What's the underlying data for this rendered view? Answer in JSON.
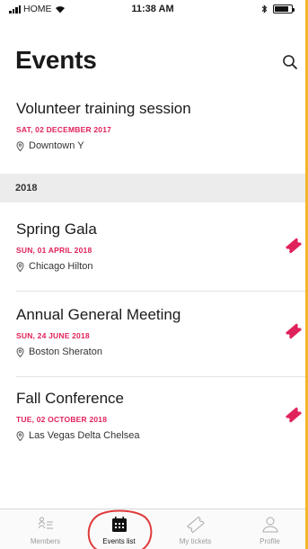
{
  "status_bar": {
    "carrier": "HOME",
    "time": "11:38 AM",
    "battery_level": 0.85
  },
  "header": {
    "title": "Events",
    "search_icon": "search-icon"
  },
  "events_top": [
    {
      "title": "Volunteer training session",
      "date": "SAT, 02 DECEMBER 2017",
      "location": "Downtown Y"
    }
  ],
  "section": {
    "label": "2018"
  },
  "events_2018": [
    {
      "title": "Spring Gala",
      "date": "SUN, 01 APRIL 2018",
      "location": "Chicago Hilton",
      "ticket_icon": "ticket-icon"
    },
    {
      "title": "Annual General Meeting",
      "date": "SUN, 24 JUNE 2018",
      "location": "Boston Sheraton",
      "ticket_icon": "ticket-icon"
    },
    {
      "title": "Fall Conference",
      "date": "TUE, 02 OCTOBER 2018",
      "location": "Las Vegas Delta Chelsea",
      "ticket_icon": "ticket-icon"
    }
  ],
  "tab_bar": {
    "active": "Events list",
    "tabs": [
      {
        "label": "Members",
        "icon": "members-icon"
      },
      {
        "label": "Events list",
        "icon": "calendar-icon"
      },
      {
        "label": "My tickets",
        "icon": "ticket-outline-icon"
      },
      {
        "label": "Profile",
        "icon": "profile-icon"
      }
    ]
  },
  "colors": {
    "accent": "#e0225a",
    "section_bg": "#ececec",
    "tab_inactive": "#9c9c9c",
    "annotation_circle": "#e03a3a",
    "frame_border": "#f2b72a"
  }
}
